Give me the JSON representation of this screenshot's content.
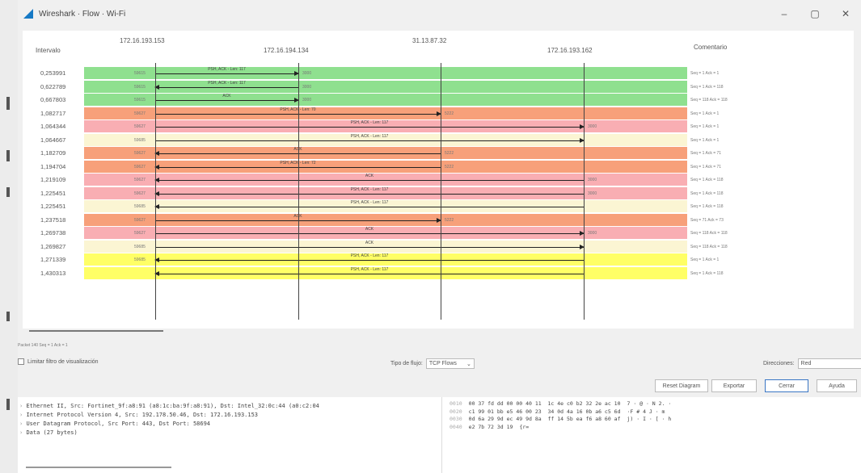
{
  "window": {
    "title": "Wireshark · Flow · Wi-Fi"
  },
  "columns": {
    "interval": "Intervalo",
    "comment": "Comentario",
    "hosts": [
      "172.16.193.153",
      "172.16.194.134",
      "31.13.87.32",
      "172.16.193.162"
    ]
  },
  "colors": {
    "green": "#8fe08f",
    "orange": "#f7a07a",
    "pink": "#f9aeb3",
    "cream": "#fbf5d3",
    "yellow": "#ffff66"
  },
  "rows": [
    {
      "time": "0,253991",
      "color": "green",
      "src_port": "59615",
      "from": 0,
      "to": 1,
      "label": "PSH, ACK - Len: 117",
      "dst_port": "3000",
      "comment": "Seq = 1 Ack = 1"
    },
    {
      "time": "0,622789",
      "color": "green",
      "src_port": "59615",
      "from": 1,
      "to": 0,
      "label": "PSH, ACK - Len: 117",
      "dst_port": "3000",
      "comment": "Seq = 1 Ack = 118"
    },
    {
      "time": "0,667803",
      "color": "green",
      "src_port": "59615",
      "from": 0,
      "to": 1,
      "label": "ACK",
      "dst_port": "3000",
      "comment": "Seq = 118 Ack = 118"
    },
    {
      "time": "1,082717",
      "color": "orange",
      "src_port": "59627",
      "from": 0,
      "to": 2,
      "label": "PSH, ACK - Len: 70",
      "dst_port": "5222",
      "comment": "Seq = 1 Ack = 1"
    },
    {
      "time": "1,064344",
      "color": "pink",
      "src_port": "59627",
      "from": 0,
      "to": 3,
      "label": "PSH, ACK - Len: 117",
      "dst_port": "3000",
      "comment": "Seq = 1 Ack = 1"
    },
    {
      "time": "1,064667",
      "color": "cream",
      "src_port": "59685",
      "from": 0,
      "to": 3,
      "label": "PSH, ACK - Len: 117",
      "dst_port": "",
      "comment": "Seq = 1 Ack = 1"
    },
    {
      "time": "1,182709",
      "color": "orange",
      "src_port": "59627",
      "from": 2,
      "to": 0,
      "label": "ACK",
      "dst_port": "5222",
      "comment": "Seq = 1 Ack = 71"
    },
    {
      "time": "1,194704",
      "color": "orange",
      "src_port": "59627",
      "from": 2,
      "to": 0,
      "label": "PSH, ACK - Len: 72",
      "dst_port": "5222",
      "comment": "Seq = 1 Ack = 71"
    },
    {
      "time": "1,219109",
      "color": "pink",
      "src_port": "59627",
      "from": 3,
      "to": 0,
      "label": "ACK",
      "dst_port": "3000",
      "comment": "Seq = 1 Ack = 118"
    },
    {
      "time": "1,225451",
      "color": "pink",
      "src_port": "59627",
      "from": 3,
      "to": 0,
      "label": "PSH, ACK - Len: 117",
      "dst_port": "3000",
      "comment": "Seq = 1 Ack = 118"
    },
    {
      "time": "1,225451",
      "color": "cream",
      "src_port": "59685",
      "from": 3,
      "to": 0,
      "label": "PSH, ACK - Len: 117",
      "dst_port": "",
      "comment": "Seq = 1 Ack = 118"
    },
    {
      "time": "1,237518",
      "color": "orange",
      "src_port": "59627",
      "from": 0,
      "to": 2,
      "label": "ACK",
      "dst_port": "5222",
      "comment": "Seq = 71 Ack = 73"
    },
    {
      "time": "1,269738",
      "color": "pink",
      "src_port": "59627",
      "from": 0,
      "to": 3,
      "label": "ACK",
      "dst_port": "3000",
      "comment": "Seq = 118 Ack = 118"
    },
    {
      "time": "1,269827",
      "color": "cream",
      "src_port": "59685",
      "from": 0,
      "to": 3,
      "label": "ACK",
      "dst_port": "",
      "comment": "Seq = 118 Ack = 118"
    },
    {
      "time": "1,271339",
      "color": "yellow",
      "src_port": "59685",
      "from": 3,
      "to": 0,
      "label": "PSH, ACK - Len: 117",
      "dst_port": "",
      "comment": "Seq = 1 Ack = 1"
    },
    {
      "time": "1,430313",
      "color": "yellow",
      "src_port": "",
      "from": 3,
      "to": 0,
      "label": "PSH, ACK - Len: 117",
      "dst_port": "",
      "comment": "Seq = 1 Ack = 118"
    }
  ],
  "status": "Packet 140 Seq = 1 Ack = 1",
  "controls": {
    "limit_filter_label": "Limitar filtro de visualización",
    "flow_type_label": "Tipo de flujo:",
    "flow_type_value": "TCP Flows",
    "directions_label": "Direcciones:",
    "directions_value": "Red",
    "reset": "Reset Diagram",
    "export": "Exportar",
    "close": "Cerrar",
    "help": "Ayuda"
  },
  "details": [
    "Ethernet II, Src: Fortinet_9f:a8:91 (a8:1c:ba:9f:a8:91), Dst: Intel_32:0c:44 (a0:c2:04",
    "Internet Protocol Version 4, Src: 192.178.50.46, Dst: 172.16.193.153",
    "User Datagram Protocol, Src Port: 443, Dst Port: 58694",
    "Data (27 bytes)"
  ],
  "hex": [
    {
      "offset": "0010",
      "bytes": "00 37 fd dd 00 00 40 11  1c 4e c0 b2 32 2e ac 10",
      "ascii": "7 · @ · N 2. ·"
    },
    {
      "offset": "0020",
      "bytes": "c1 99 01 bb e5 46 00 23  34 0d 4a 16 0b a6 c5 6d",
      "ascii": "·F # 4 J · m"
    },
    {
      "offset": "0030",
      "bytes": "0d 6a 29 9d ec 49 9d 8a  ff 14 5b ea f6 a8 60 af",
      "ascii": "j) · I · [ · h"
    },
    {
      "offset": "0040",
      "bytes": "e2 7b 72 3d 19",
      "ascii": "{r="
    }
  ]
}
